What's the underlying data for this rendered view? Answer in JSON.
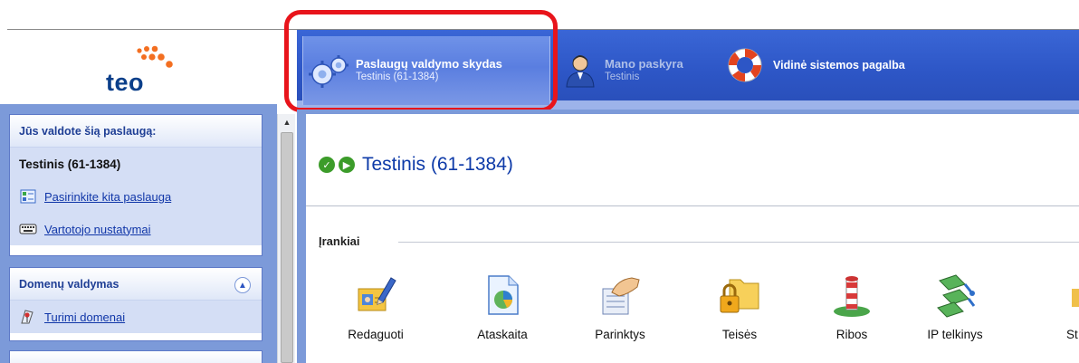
{
  "logo": {
    "text": "teo"
  },
  "tabs": [
    {
      "title": "Paslaugų valdymo skydas",
      "subtitle": "Testinis (61-1384)",
      "icon": "gears-icon"
    },
    {
      "title": "Mano paskyra",
      "subtitle": "Testinis",
      "icon": "user-icon"
    },
    {
      "title": "Vidinė sistemos pagalba",
      "subtitle": "",
      "icon": "lifebuoy-icon"
    }
  ],
  "sidebar": {
    "service_panel": {
      "heading": "Jūs valdote šią paslaugą:",
      "service_name": "Testinis (61-1384)",
      "links": [
        {
          "label": "Pasirinkite kita paslauga",
          "icon": "list-icon"
        },
        {
          "label": "Vartotojo nustatymai",
          "icon": "keyboard-icon"
        }
      ]
    },
    "domain_panel": {
      "heading": "Domenų valdymas",
      "links": [
        {
          "label": "Turimi domenai",
          "icon": "map-pin-icon"
        }
      ]
    }
  },
  "main": {
    "title": "Testinis (61-1384)",
    "section_label": "Įrankiai",
    "tools": [
      {
        "label": "Redaguoti",
        "icon": "edit-icon"
      },
      {
        "label": "Ataskaita",
        "icon": "report-icon"
      },
      {
        "label": "Parinktys",
        "icon": "options-icon"
      },
      {
        "label": "Teisės",
        "icon": "lock-folder-icon"
      },
      {
        "label": "Ribos",
        "icon": "boundary-post-icon"
      },
      {
        "label": "IP telkinys",
        "icon": "network-icon"
      },
      {
        "label": "St",
        "icon": "partial-icon"
      }
    ]
  },
  "colors": {
    "header_blue": "#2d56c6",
    "active_tab": "#5a7ee0",
    "highlight": "#e8141b",
    "title_blue": "#0d3aa8",
    "sidebar_blue": "#7c9ad9"
  }
}
